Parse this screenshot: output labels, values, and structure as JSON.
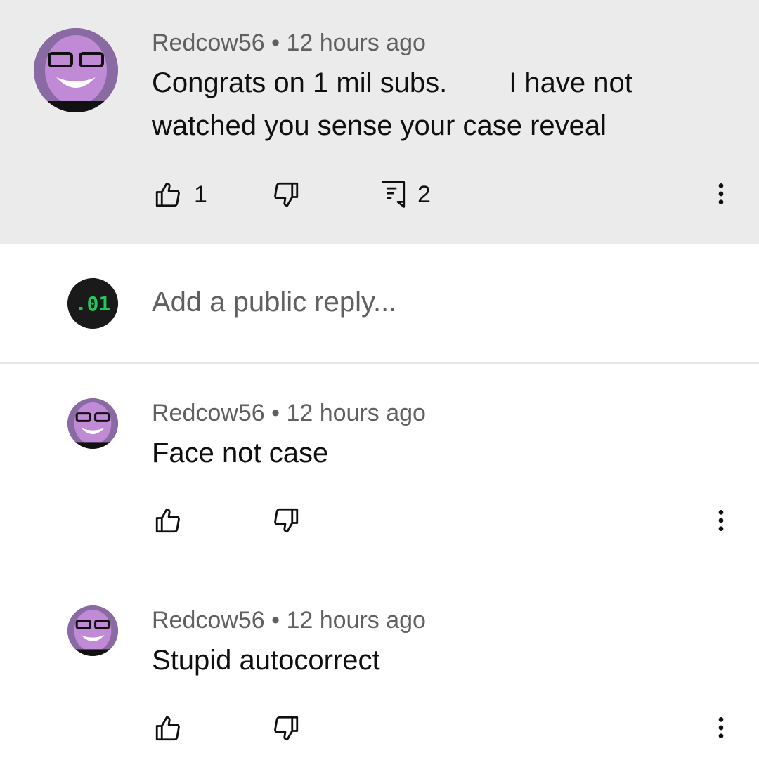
{
  "top_comment": {
    "author": "Redcow56",
    "separator": "•",
    "time": "12 hours ago",
    "text_line1_part1": "Congrats on 1 mil subs.",
    "text_line1_part2": "I have not",
    "text_line2": "watched you sense your case reveal",
    "like_count": "1",
    "reply_count": "2",
    "icons": [
      "thumb-up-icon",
      "thumb-down-icon",
      "reply-icon",
      "more-vert-icon"
    ]
  },
  "reply_box": {
    "placeholder": "Add a public reply...",
    "avatar_text": ".01",
    "avatar_color": "#22c55e"
  },
  "replies": [
    {
      "author": "Redcow56",
      "separator": "•",
      "time": "12 hours ago",
      "text": "Face not case"
    },
    {
      "author": "Redcow56",
      "separator": "•",
      "time": "12 hours ago",
      "text": "Stupid autocorrect"
    }
  ],
  "colors": {
    "highlight_bg": "#ebebeb",
    "meta_text": "#606060",
    "primary_text": "#0f0f0f"
  }
}
